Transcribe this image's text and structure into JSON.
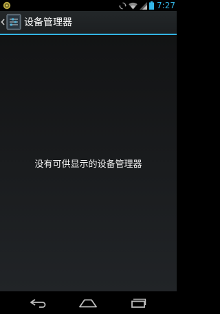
{
  "status_bar": {
    "time": "7:27",
    "icons": [
      "notification-icon",
      "sync-icon",
      "wifi-icon",
      "signal-icon",
      "battery-icon"
    ],
    "accent_color": "#33b5e5"
  },
  "action_bar": {
    "title": "设备管理器",
    "icons": [
      "up-caret-icon",
      "settings-app-icon"
    ],
    "accent_color": "#33b5e5"
  },
  "content": {
    "empty_message": "没有可供显示的设备管理器"
  },
  "nav_bar": {
    "buttons": [
      "back-icon",
      "home-icon",
      "recent-apps-icon"
    ]
  }
}
